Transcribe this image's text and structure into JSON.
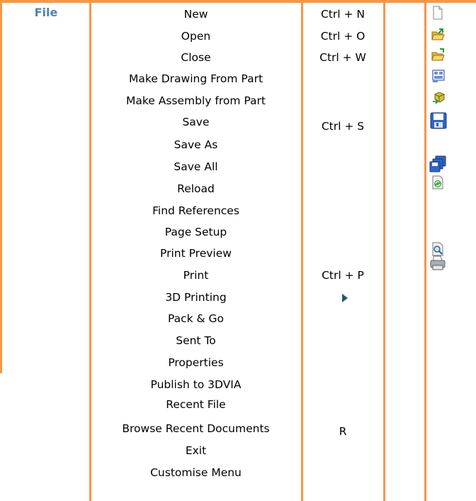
{
  "menu": {
    "label": "File"
  },
  "items": [
    {
      "label": "New",
      "shortcut": "Ctrl + N",
      "icon": "new-document-icon"
    },
    {
      "label": "Open",
      "shortcut": "Ctrl + O",
      "icon": "open-folder-icon"
    },
    {
      "label": "Close",
      "shortcut": "Ctrl + W",
      "icon": "close-folder-icon"
    },
    {
      "label": "Make Drawing From Part",
      "shortcut": "",
      "icon": "make-drawing-icon"
    },
    {
      "label": "Make Assembly from Part",
      "shortcut": "",
      "icon": "make-assembly-icon"
    },
    {
      "label": "Save",
      "shortcut": "Ctrl + S",
      "icon": "save-icon"
    },
    {
      "label": "Save As",
      "shortcut": "",
      "icon": ""
    },
    {
      "label": "Save All",
      "shortcut": "",
      "icon": "save-all-icon"
    },
    {
      "label": "Reload",
      "shortcut": "",
      "icon": "reload-icon"
    },
    {
      "label": "Find References",
      "shortcut": "",
      "icon": ""
    },
    {
      "label": "Page Setup",
      "shortcut": "",
      "icon": ""
    },
    {
      "label": "Print Preview",
      "shortcut": "",
      "icon": "print-preview-icon"
    },
    {
      "label": "Print",
      "shortcut": "Ctrl + P",
      "icon": "printer-icon"
    },
    {
      "label": "3D Printing",
      "shortcut": "",
      "icon": "submenu-arrow-icon"
    },
    {
      "label": "Pack & Go",
      "shortcut": "",
      "icon": ""
    },
    {
      "label": "Sent To",
      "shortcut": "",
      "icon": ""
    },
    {
      "label": "Properties",
      "shortcut": "",
      "icon": ""
    },
    {
      "label": "Publish to 3DVIA",
      "shortcut": "",
      "icon": ""
    },
    {
      "label": "Recent File",
      "shortcut": "",
      "icon": ""
    },
    {
      "label": "Browse Recent Documents",
      "shortcut": "R",
      "icon": ""
    },
    {
      "label": "Exit",
      "shortcut": "",
      "icon": ""
    },
    {
      "label": "Customise Menu",
      "shortcut": "",
      "icon": ""
    }
  ],
  "colors": {
    "border": "#f79646",
    "menu_label": "#4f81bd"
  }
}
